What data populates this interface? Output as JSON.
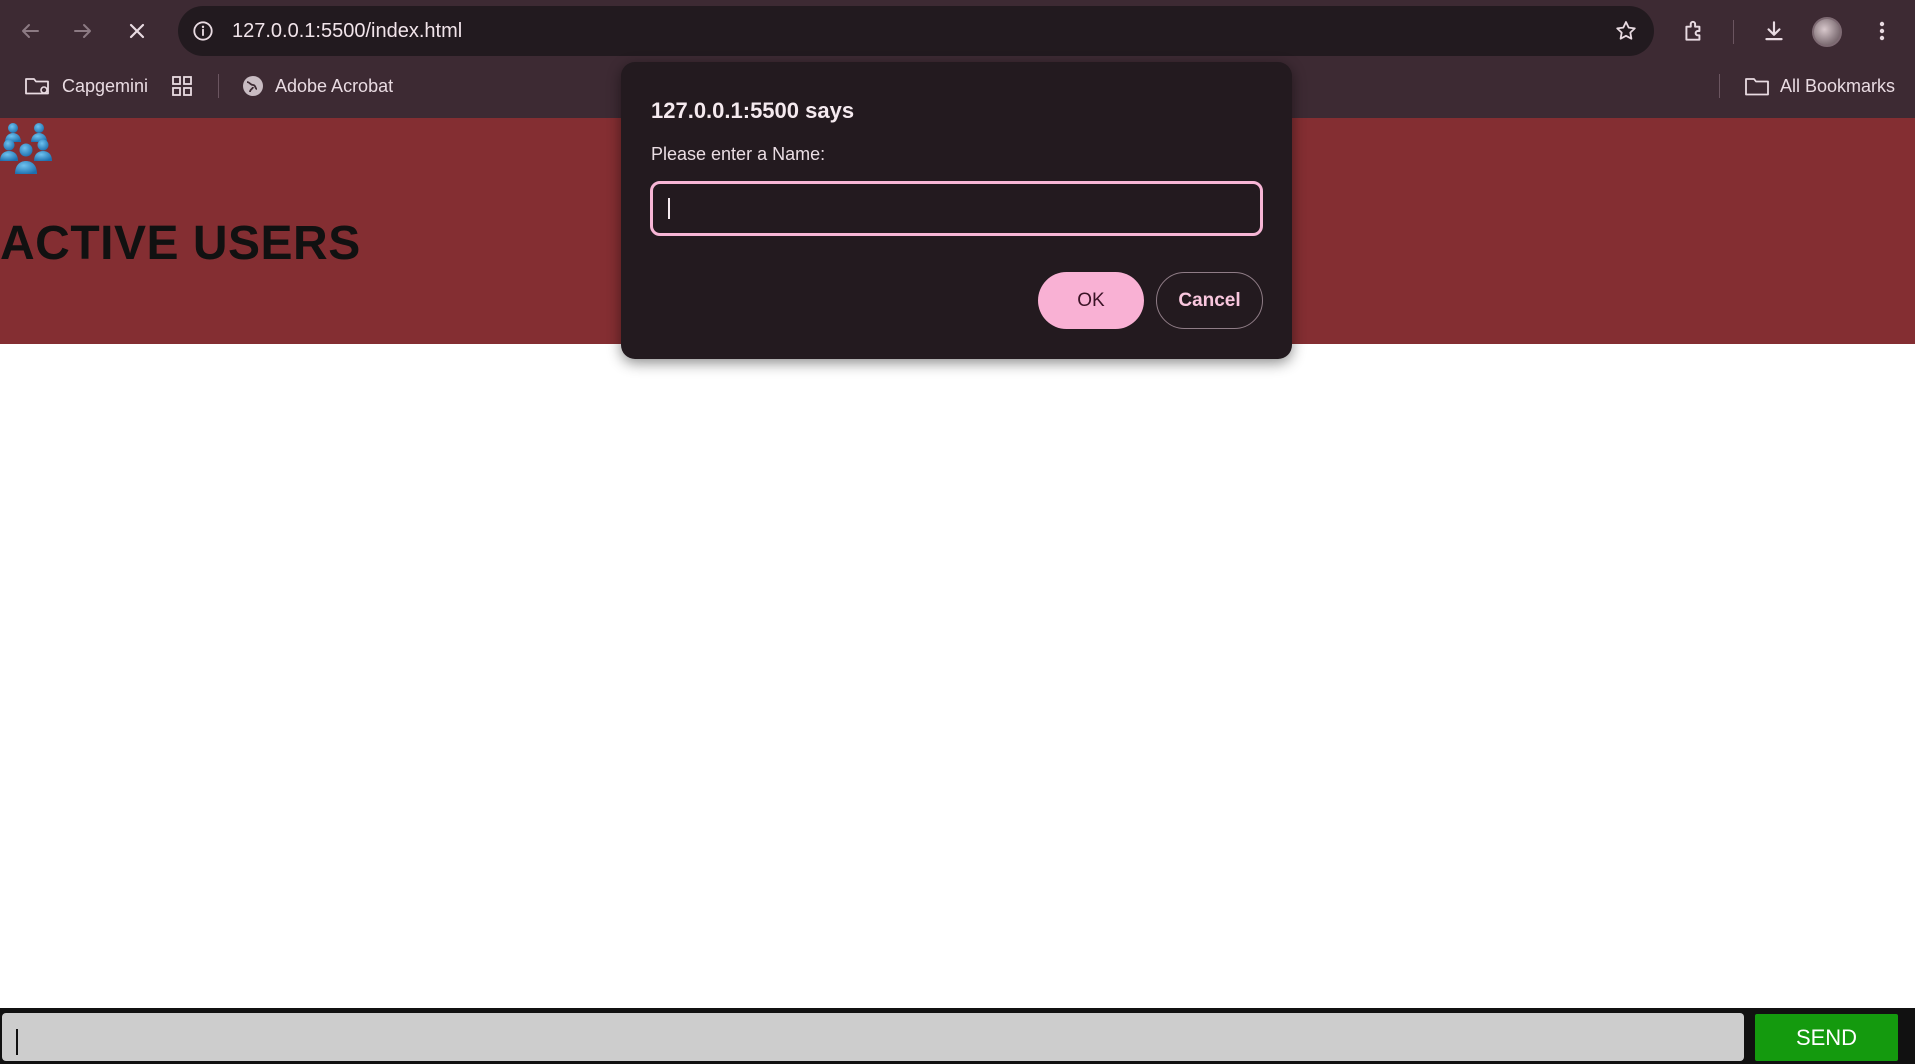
{
  "browser": {
    "url": "127.0.0.1:5500/index.html",
    "bookmarks": [
      {
        "label": "Capgemini",
        "icon": "folder-settings-icon"
      },
      {
        "label": "",
        "icon": "apps-grid-icon"
      },
      {
        "label": "Adobe Acrobat",
        "icon": "globe-icon"
      }
    ],
    "all_bookmarks_label": "All Bookmarks"
  },
  "page": {
    "title": "ACTIVE USERS",
    "send_label": "SEND",
    "message_value": "",
    "colors": {
      "header": "#842e32",
      "send": "#149a0e"
    }
  },
  "dialog": {
    "title": "127.0.0.1:5500 says",
    "message": "Please enter a Name:",
    "input_value": "",
    "ok_label": "OK",
    "cancel_label": "Cancel",
    "accent": "#f9b1d4"
  }
}
